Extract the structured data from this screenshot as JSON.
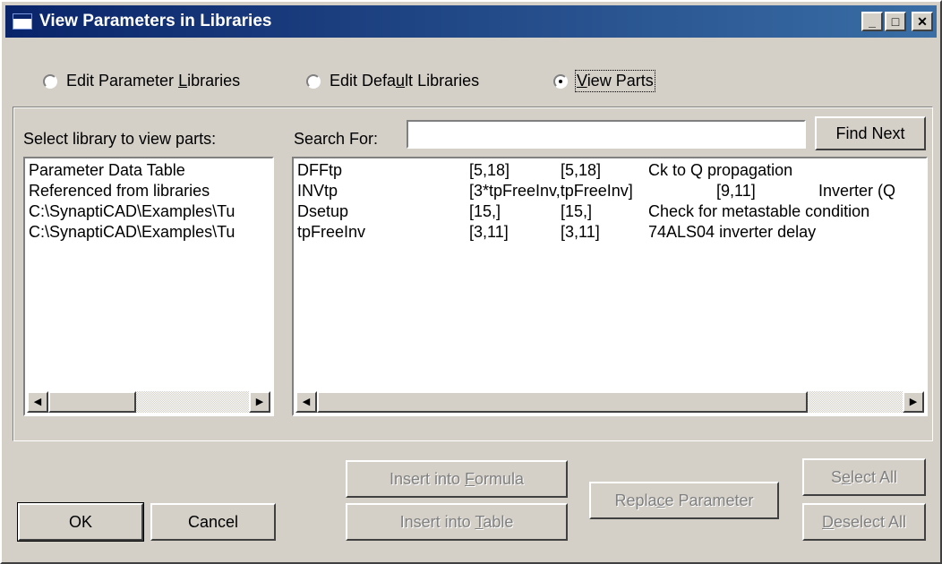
{
  "window": {
    "title": "View Parameters in Libraries",
    "minimize_glyph": "_",
    "maximize_glyph": "□",
    "close_glyph": "✕"
  },
  "modes": [
    {
      "pre": "Edit Parameter ",
      "u": "L",
      "post": "ibraries",
      "selected": false
    },
    {
      "pre": "Edit Defa",
      "u": "u",
      "post": "lt Libraries",
      "selected": false
    },
    {
      "pre": "",
      "u": "V",
      "post": "iew Parts",
      "selected": true
    }
  ],
  "library_panel": {
    "label": "Select library to view parts:",
    "items": [
      "Parameter Data Table",
      "Referenced from libraries",
      "C:\\SynaptiCAD\\Examples\\Tu",
      "C:\\SynaptiCAD\\Examples\\Tu"
    ]
  },
  "search": {
    "label": "Search For:",
    "value": "",
    "find_next_label": "Find Next"
  },
  "parts": [
    {
      "name": "DFFtp",
      "v1": "[5,18]",
      "v2": "[5,18]",
      "desc": "Ck to Q propagation"
    },
    {
      "name": "INVtp",
      "v1": "[3*tpFreeInv,tpFreeInv]",
      "v2": "[9,11]",
      "desc": "Inverter (Q"
    },
    {
      "name": "Dsetup",
      "v1": "[15,]",
      "v2": "[15,]",
      "desc": "Check for metastable condition"
    },
    {
      "name": "tpFreeInv",
      "v1": "[3,11]",
      "v2": "[3,11]",
      "desc": "74ALS04 inverter delay"
    }
  ],
  "buttons": {
    "ok": "OK",
    "cancel": "Cancel",
    "insert_formula": {
      "pre": "Insert into ",
      "u": "F",
      "post": "ormula"
    },
    "insert_table": {
      "pre": "Insert into ",
      "u": "T",
      "post": "able"
    },
    "replace": {
      "pre": "Repla",
      "u": "c",
      "post": "e Parameter"
    },
    "select_all": {
      "pre": "S",
      "u": "e",
      "post": "lect All"
    },
    "deselect_all": {
      "pre": "",
      "u": "D",
      "post": "eselect All"
    }
  },
  "scroll_glyphs": {
    "left": "◀",
    "right": "▶"
  }
}
